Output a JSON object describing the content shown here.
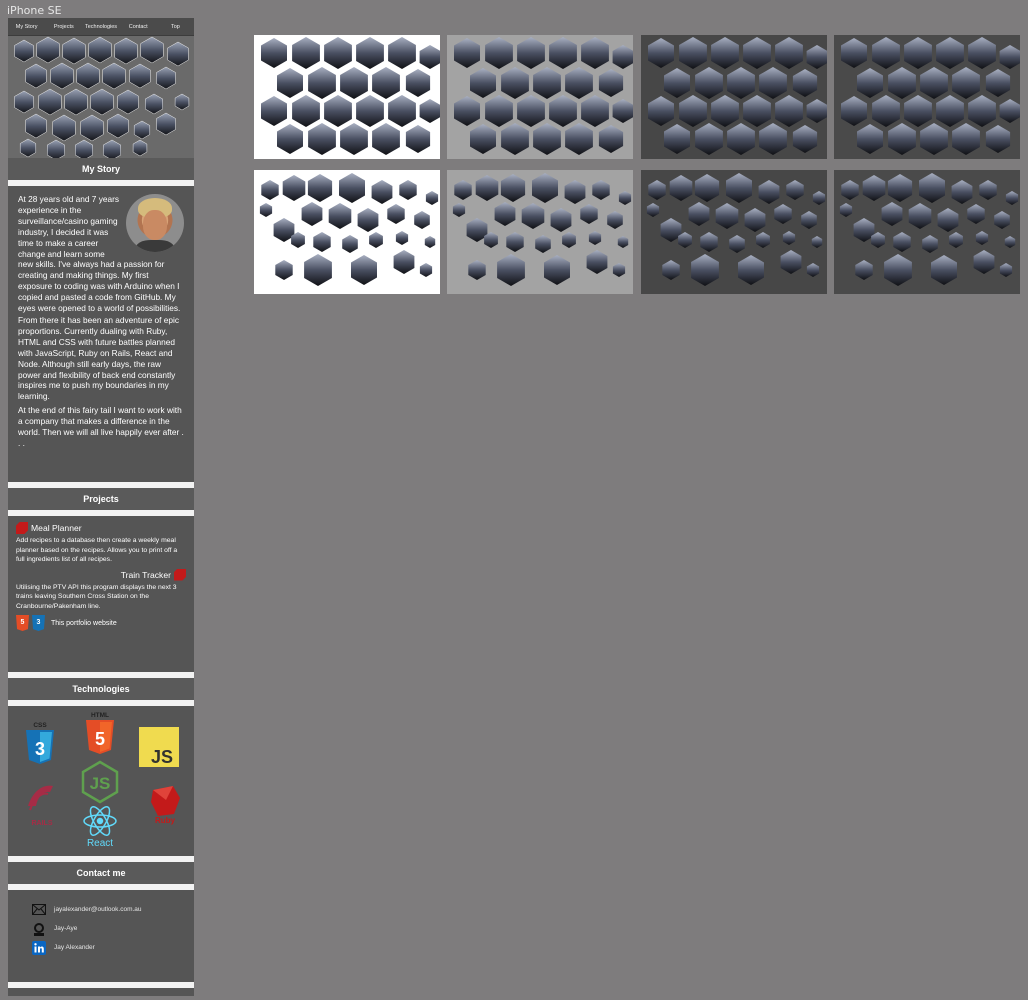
{
  "frame": {
    "label": "iPhone SE"
  },
  "nav": [
    "My Story",
    "Projects",
    "Technologies",
    "Contact",
    "Top"
  ],
  "sections": {
    "story_title": "My Story",
    "projects_title": "Projects",
    "tech_title": "Technologies",
    "contact_title": "Contact me"
  },
  "story": {
    "p1": "At 28 years old and 7 years experience in the surveillance/casino gaming industry, I decided it was time to make a career change and learn some new skills.  I've always had a passion for creating and making things. My first exposure to coding was with Arduino when I copied and pasted a code from GitHub. My eyes were opened to a world of possibilities.",
    "p2": "From there it has been an adventure of epic proportions. Currently dualing with Ruby, HTML and CSS with future battles planned with JavaScript, Ruby on Rails, React and Node. Although still early days, the raw power and flexibility of back end constantly inspires me to push my boundaries in my learning.",
    "p3": "At the end of this fairy tail I want to work with a company that makes a difference in the world. Then we will all live happily ever after . . ."
  },
  "projects": [
    {
      "name": "Meal Planner",
      "desc": "Add recipes to a database then create a weekly meal planner based on the recipes. Allows you to print off a full ingredients list of all recipes."
    },
    {
      "name": "Train Tracker",
      "desc": "Utilising the PTV API this program displays the next 3 trains leaving Southern Cross Station on the Cranbourne/Pakenham line."
    },
    {
      "name": "This portfolio website"
    }
  ],
  "tech_logos": {
    "css": "CSS",
    "css_num": "3",
    "html": "HTML",
    "html_num": "5",
    "js": "JS",
    "node": "JS",
    "rails": "RAILS",
    "ruby": "Ruby",
    "react": "React"
  },
  "contact": {
    "email": "jayalexander@outlook.com.au",
    "github": "Jay-Aye",
    "linkedin": "Jay Alexander"
  },
  "thumb_backgrounds": [
    "#ffffff",
    "#a3a3a3",
    "#474747",
    "#4a4a4a",
    "#ffffff",
    "#a3a3a3",
    "#474747",
    "#4a4a4a"
  ]
}
